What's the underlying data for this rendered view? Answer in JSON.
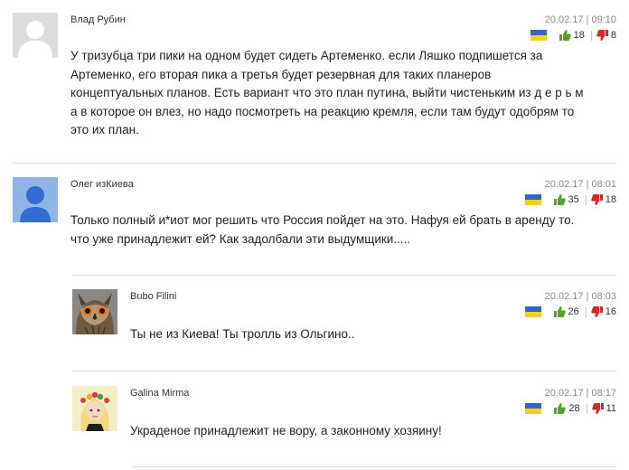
{
  "comments": [
    {
      "author": "Влад Рубин",
      "date": "20.02.17 | 09:10",
      "likes": "18",
      "dislikes": "8",
      "avatar": "default-gray",
      "text_lines": [
        "У тризубца три пики на одном будет сидеть Артеменко. если Ляшко подпишется за",
        "Артеменко, его вторая пика а третья будет резервная для таких планеров",
        "концептуальных планов. Есть вариант что это план путина, выйти чистеньким из д е р ь м",
        "а в которое он влез, но надо посмотреть на реакцию кремля, если там будут одобрям то",
        "это их план."
      ]
    },
    {
      "author": "Олег изКиева",
      "date": "20.02.17 | 08:01",
      "likes": "35",
      "dislikes": "18",
      "avatar": "default-blue",
      "text_lines": [
        "Только полный и*иот мог решить что Россия пойдет на это. Нафуя ей брать в аренду то.",
        "что уже принадлежит ей? Как задолбали эти выдумщики....."
      ]
    },
    {
      "author": "Bubo Filini",
      "date": "20.02.17 | 08:03",
      "likes": "26",
      "dislikes": "16",
      "avatar": "owl-photo",
      "text_lines": [
        "Ты не из Киева! Ты тролль из Ольгино.."
      ]
    },
    {
      "author": "Galina Mirma",
      "date": "20.02.17 | 08:17",
      "likes": "28",
      "dislikes": "11",
      "avatar": "girl-flower-wreath-illustration",
      "text_lines": [
        "Украденое принадлежит не вору, а законному хозяину!"
      ]
    }
  ],
  "colors": {
    "like": "#5aa02c",
    "dislike": "#d9252b",
    "flag_blue": "#2f67c9",
    "flag_yellow": "#f4cf1c",
    "date": "#8a8a8a",
    "divider": "#dcdcdc"
  },
  "icons": [
    "ukraine-flag-icon",
    "thumbs-up-icon",
    "thumbs-down-icon"
  ]
}
